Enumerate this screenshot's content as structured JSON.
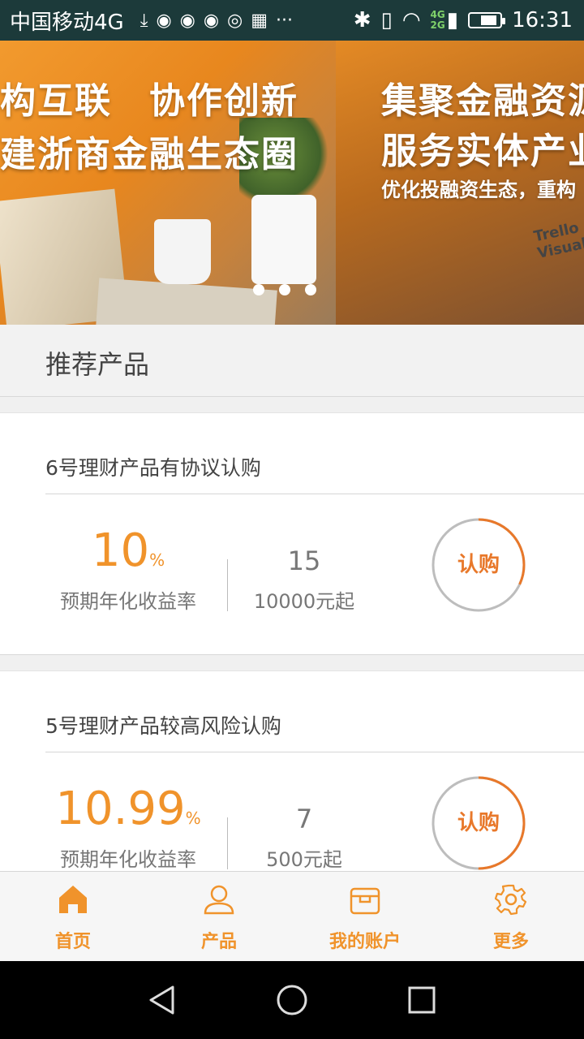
{
  "status_bar": {
    "carrier": "中国移动4G",
    "network_badge_top": "4G",
    "network_badge_bottom": "2G",
    "time": "16:31",
    "battery_level": 0.55
  },
  "banner": {
    "slide1_line1": "构互联　协作创新",
    "slide1_line2": "建浙商金融生态圈",
    "slide2_line1": "集聚金融资源",
    "slide2_line2": "服务实体产业",
    "slide2_sub": "优化投融资生态，重构",
    "tablet_text": "Trello Visual",
    "active_dot": 3
  },
  "section": {
    "title": "推荐产品"
  },
  "products": [
    {
      "title": "6号理财产品有协议认购",
      "rate": "10",
      "rate_unit": "%",
      "rate_label": "预期年化收益率",
      "term": "15",
      "min_amount": "10000元起",
      "buy_label": "认购",
      "progress": 0.32
    },
    {
      "title": "5号理财产品较高风险认购",
      "rate": "10.99",
      "rate_unit": "%",
      "rate_label": "预期年化收益率",
      "term": "7",
      "min_amount": "500元起",
      "buy_label": "认购",
      "progress": 0.5
    }
  ],
  "bottom_nav": {
    "items": [
      {
        "label": "首页",
        "icon": "home-icon"
      },
      {
        "label": "产品",
        "icon": "user-icon"
      },
      {
        "label": "我的账户",
        "icon": "box-icon"
      },
      {
        "label": "更多",
        "icon": "gear-icon"
      }
    ]
  },
  "colors": {
    "accent": "#f0932b",
    "status_bar": "#1c3a3a",
    "active_dot": "#e60000"
  }
}
